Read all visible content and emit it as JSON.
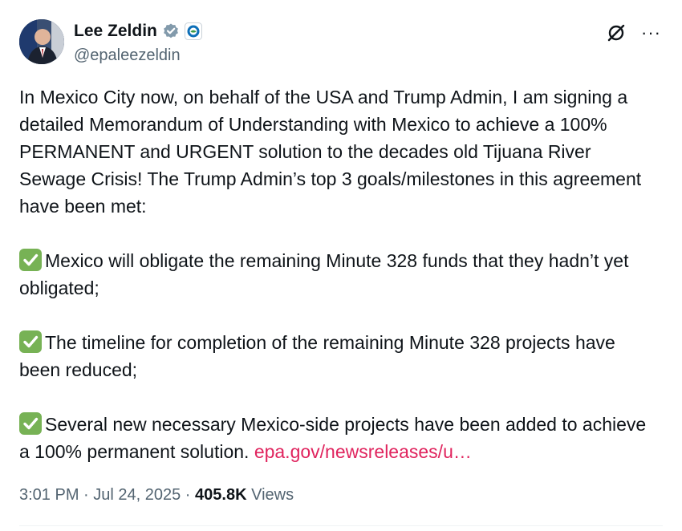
{
  "author": {
    "name": "Lee Zeldin",
    "handle": "@epaleezeldin"
  },
  "icons": {
    "verified": "verified-badge-icon",
    "affiliation": "epa-logo-icon",
    "grok": "grok-icon",
    "more": "more-icon",
    "check": "check-mark-icon"
  },
  "colors": {
    "link": "#e0245e",
    "check": "#77b255",
    "secondary": "#536471"
  },
  "tweet": {
    "intro": "In Mexico City now, on behalf of the USA and Trump Admin, I am signing a detailed Memorandum of Understanding with Mexico to achieve a 100% PERMANENT and URGENT solution to the decades old Tijuana River Sewage Crisis! The Trump Admin’s top 3 goals/milestones in this agreement have been met:",
    "point1": "Mexico will obligate the remaining Minute 328 funds that they hadn’t yet obligated;",
    "point2": "The timeline for completion of the remaining Minute 328 projects have been reduced;",
    "point3": "Several new necessary Mexico-side projects have been added to achieve a 100% permanent solution.",
    "link": "epa.gov/newsreleases/u…"
  },
  "meta": {
    "time": "3:01 PM",
    "sep1": " · ",
    "date": "Jul 24, 2025",
    "sep2": " · ",
    "views_count": "405.8K",
    "views_label": " Views"
  },
  "more_label": "···"
}
